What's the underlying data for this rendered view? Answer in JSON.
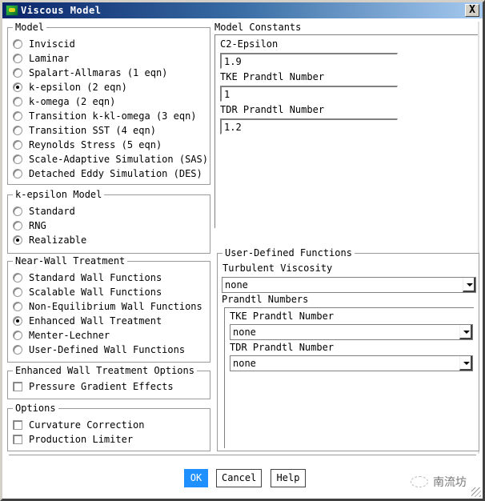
{
  "window": {
    "title": "Viscous Model",
    "close_label": "X"
  },
  "model": {
    "title": "Model",
    "options": [
      {
        "label": "Inviscid",
        "selected": false
      },
      {
        "label": "Laminar",
        "selected": false
      },
      {
        "label": "Spalart-Allmaras (1 eqn)",
        "selected": false
      },
      {
        "label": "k-epsilon (2 eqn)",
        "selected": true
      },
      {
        "label": "k-omega (2 eqn)",
        "selected": false
      },
      {
        "label": "Transition k-kl-omega (3 eqn)",
        "selected": false
      },
      {
        "label": "Transition SST (4 eqn)",
        "selected": false
      },
      {
        "label": "Reynolds Stress (5 eqn)",
        "selected": false
      },
      {
        "label": "Scale-Adaptive Simulation (SAS)",
        "selected": false
      },
      {
        "label": "Detached Eddy Simulation (DES)",
        "selected": false
      }
    ]
  },
  "kepsilon_model": {
    "title": "k-epsilon Model",
    "options": [
      {
        "label": "Standard",
        "selected": false
      },
      {
        "label": "RNG",
        "selected": false
      },
      {
        "label": "Realizable",
        "selected": true
      }
    ]
  },
  "near_wall": {
    "title": "Near-Wall Treatment",
    "options": [
      {
        "label": "Standard Wall Functions",
        "selected": false
      },
      {
        "label": "Scalable Wall Functions",
        "selected": false
      },
      {
        "label": "Non-Equilibrium Wall Functions",
        "selected": false
      },
      {
        "label": "Enhanced Wall Treatment",
        "selected": true
      },
      {
        "label": "Menter-Lechner",
        "selected": false
      },
      {
        "label": "User-Defined Wall Functions",
        "selected": false
      }
    ]
  },
  "ewt_options": {
    "title": "Enhanced Wall Treatment Options",
    "checks": [
      {
        "label": "Pressure Gradient Effects",
        "checked": false
      }
    ]
  },
  "options": {
    "title": "Options",
    "checks": [
      {
        "label": "Curvature Correction",
        "checked": false
      },
      {
        "label": "Production Limiter",
        "checked": false
      }
    ]
  },
  "constants": {
    "title": "Model Constants",
    "fields": [
      {
        "label": "C2-Epsilon",
        "value": "1.9"
      },
      {
        "label": "TKE Prandtl Number",
        "value": "1"
      },
      {
        "label": "TDR Prandtl Number",
        "value": "1.2"
      }
    ]
  },
  "udf": {
    "title": "User-Defined Functions",
    "turb_visc_label": "Turbulent Viscosity",
    "turb_visc_value": "none",
    "prandtl_title": "Prandtl Numbers",
    "tke_label": "TKE Prandtl Number",
    "tke_value": "none",
    "tdr_label": "TDR Prandtl Number",
    "tdr_value": "none"
  },
  "buttons": {
    "ok": "OK",
    "cancel": "Cancel",
    "help": "Help"
  },
  "watermark": "南流坊"
}
